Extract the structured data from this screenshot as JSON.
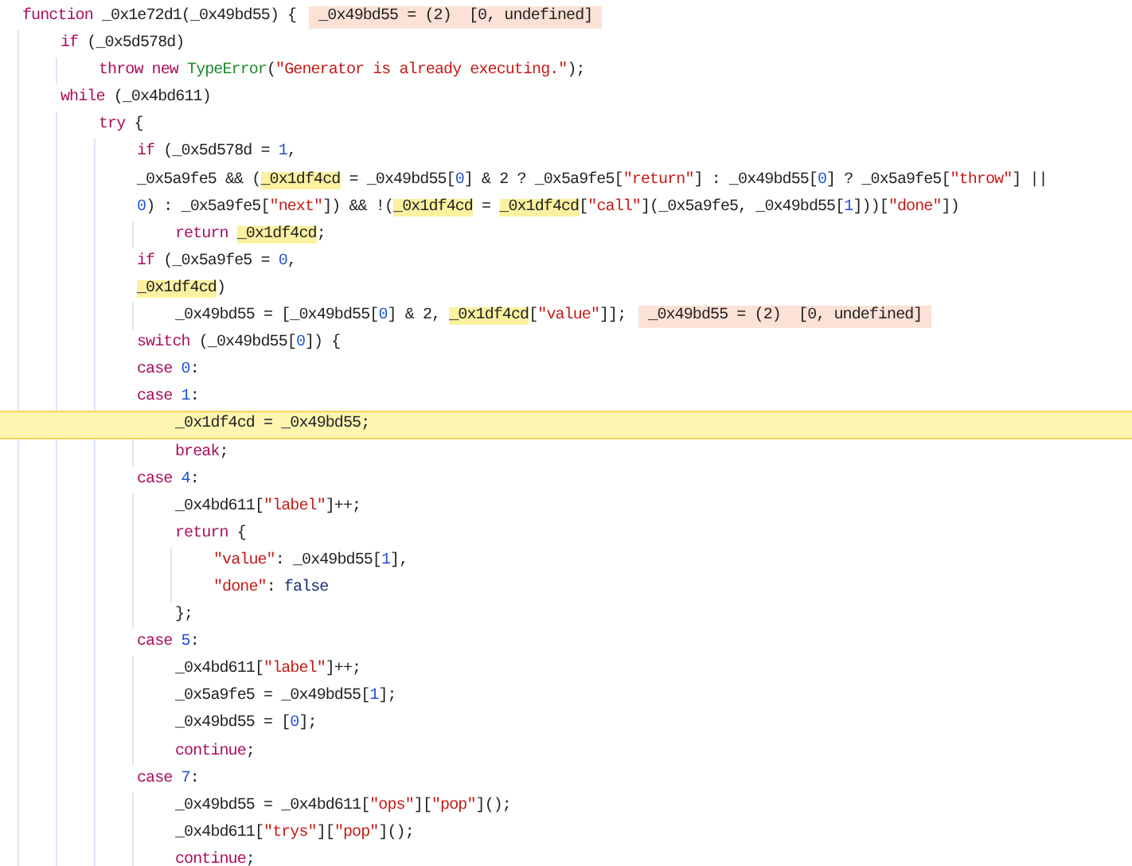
{
  "code": {
    "lines": [
      {
        "paused": false,
        "tokens": [
          {
            "kind": "kw",
            "text": "function"
          },
          {
            "kind": "p",
            "text": " _0x1e72d1(_0x49bd55) {"
          }
        ],
        "inline_value": "_0x49bd55 = (2)  [0, undefined]",
        "children": [
          {
            "paused": false,
            "tokens": [
              {
                "kind": "kw",
                "text": "if"
              },
              {
                "kind": "p",
                "text": " (_0x5d578d)"
              }
            ],
            "children": [
              {
                "paused": false,
                "tokens": [
                  {
                    "kind": "kw",
                    "text": "throw new "
                  },
                  {
                    "kind": "ty",
                    "text": "TypeError"
                  },
                  {
                    "kind": "p",
                    "text": "("
                  },
                  {
                    "kind": "s",
                    "text": "\"Generator is already executing.\""
                  },
                  {
                    "kind": "p",
                    "text": ");"
                  }
                ]
              }
            ]
          },
          {
            "paused": false,
            "tokens": [
              {
                "kind": "kw",
                "text": "while"
              },
              {
                "kind": "p",
                "text": " (_0x4bd611)"
              }
            ],
            "children": [
              {
                "paused": false,
                "tokens": [
                  {
                    "kind": "kw",
                    "text": "try"
                  },
                  {
                    "kind": "p",
                    "text": " {"
                  }
                ],
                "children": [
                  {
                    "paused": false,
                    "tokens": [
                      {
                        "kind": "kw",
                        "text": "if"
                      },
                      {
                        "kind": "p",
                        "text": " (_0x5d578d = "
                      },
                      {
                        "kind": "n",
                        "text": "1"
                      },
                      {
                        "kind": "p",
                        "text": ","
                      }
                    ]
                  },
                  {
                    "paused": false,
                    "tokens": [
                      {
                        "kind": "p",
                        "text": "_0x5a9fe5 && ("
                      },
                      {
                        "kind": "hl",
                        "text": "_0x1df4cd"
                      },
                      {
                        "kind": "p",
                        "text": " = _0x49bd55["
                      },
                      {
                        "kind": "n",
                        "text": "0"
                      },
                      {
                        "kind": "p",
                        "text": "] & 2 ? _0x5a9fe5["
                      },
                      {
                        "kind": "s",
                        "text": "\"return\""
                      },
                      {
                        "kind": "p",
                        "text": "] : _0x49bd55["
                      },
                      {
                        "kind": "n",
                        "text": "0"
                      },
                      {
                        "kind": "p",
                        "text": "] ? _0x5a9fe5["
                      },
                      {
                        "kind": "s",
                        "text": "\"throw\""
                      },
                      {
                        "kind": "p",
                        "text": "] ||"
                      }
                    ]
                  },
                  {
                    "paused": false,
                    "tokens": [
                      {
                        "kind": "n",
                        "text": "0"
                      },
                      {
                        "kind": "p",
                        "text": ") : _0x5a9fe5["
                      },
                      {
                        "kind": "s",
                        "text": "\"next\""
                      },
                      {
                        "kind": "p",
                        "text": "]) && !("
                      },
                      {
                        "kind": "hl",
                        "text": "_0x1df4cd"
                      },
                      {
                        "kind": "p",
                        "text": " = "
                      },
                      {
                        "kind": "hl",
                        "text": "_0x1df4cd"
                      },
                      {
                        "kind": "p",
                        "text": "["
                      },
                      {
                        "kind": "s",
                        "text": "\"call\""
                      },
                      {
                        "kind": "p",
                        "text": "](_0x5a9fe5, _0x49bd55["
                      },
                      {
                        "kind": "n",
                        "text": "1"
                      },
                      {
                        "kind": "p",
                        "text": "]))["
                      },
                      {
                        "kind": "s",
                        "text": "\"done\""
                      },
                      {
                        "kind": "p",
                        "text": "])"
                      }
                    ],
                    "children": [
                      {
                        "paused": false,
                        "tokens": [
                          {
                            "kind": "kw",
                            "text": "return "
                          },
                          {
                            "kind": "hl",
                            "text": "_0x1df4cd"
                          },
                          {
                            "kind": "p",
                            "text": ";"
                          }
                        ]
                      }
                    ]
                  },
                  {
                    "paused": false,
                    "tokens": [
                      {
                        "kind": "kw",
                        "text": "if"
                      },
                      {
                        "kind": "p",
                        "text": " (_0x5a9fe5 = "
                      },
                      {
                        "kind": "n",
                        "text": "0"
                      },
                      {
                        "kind": "p",
                        "text": ","
                      }
                    ]
                  },
                  {
                    "paused": false,
                    "tokens": [
                      {
                        "kind": "hl",
                        "text": "_0x1df4cd"
                      },
                      {
                        "kind": "p",
                        "text": ")"
                      }
                    ],
                    "children": [
                      {
                        "paused": false,
                        "tokens": [
                          {
                            "kind": "p",
                            "text": "_0x49bd55 = [_0x49bd55["
                          },
                          {
                            "kind": "n",
                            "text": "0"
                          },
                          {
                            "kind": "p",
                            "text": "] & 2, "
                          },
                          {
                            "kind": "hl",
                            "text": "_0x1df4cd"
                          },
                          {
                            "kind": "p",
                            "text": "["
                          },
                          {
                            "kind": "s",
                            "text": "\"value\""
                          },
                          {
                            "kind": "p",
                            "text": "]];"
                          }
                        ],
                        "inline_value": "_0x49bd55 = (2)  [0, undefined]"
                      }
                    ]
                  },
                  {
                    "paused": false,
                    "tokens": [
                      {
                        "kind": "kw",
                        "text": "switch"
                      },
                      {
                        "kind": "p",
                        "text": " (_0x49bd55["
                      },
                      {
                        "kind": "n",
                        "text": "0"
                      },
                      {
                        "kind": "p",
                        "text": "]) {"
                      }
                    ]
                  },
                  {
                    "paused": false,
                    "tokens": [
                      {
                        "kind": "kw",
                        "text": "case "
                      },
                      {
                        "kind": "n",
                        "text": "0"
                      },
                      {
                        "kind": "p",
                        "text": ":"
                      }
                    ]
                  },
                  {
                    "paused": false,
                    "tokens": [
                      {
                        "kind": "kw",
                        "text": "case "
                      },
                      {
                        "kind": "n",
                        "text": "1"
                      },
                      {
                        "kind": "p",
                        "text": ":"
                      }
                    ],
                    "children": [
                      {
                        "paused": true,
                        "tokens": [
                          {
                            "kind": "p",
                            "text": "_0x1df4cd = _0x49bd55;"
                          }
                        ]
                      },
                      {
                        "paused": false,
                        "tokens": [
                          {
                            "kind": "kw",
                            "text": "break"
                          },
                          {
                            "kind": "p",
                            "text": ";"
                          }
                        ]
                      }
                    ]
                  },
                  {
                    "paused": false,
                    "tokens": [
                      {
                        "kind": "kw",
                        "text": "case "
                      },
                      {
                        "kind": "n",
                        "text": "4"
                      },
                      {
                        "kind": "p",
                        "text": ":"
                      }
                    ],
                    "children": [
                      {
                        "paused": false,
                        "tokens": [
                          {
                            "kind": "p",
                            "text": "_0x4bd611["
                          },
                          {
                            "kind": "s",
                            "text": "\"label\""
                          },
                          {
                            "kind": "p",
                            "text": "]++;"
                          }
                        ]
                      },
                      {
                        "paused": false,
                        "tokens": [
                          {
                            "kind": "kw",
                            "text": "return"
                          },
                          {
                            "kind": "p",
                            "text": " {"
                          }
                        ],
                        "children": [
                          {
                            "paused": false,
                            "tokens": [
                              {
                                "kind": "s",
                                "text": "\"value\""
                              },
                              {
                                "kind": "p",
                                "text": ": _0x49bd55["
                              },
                              {
                                "kind": "n",
                                "text": "1"
                              },
                              {
                                "kind": "p",
                                "text": "],"
                              }
                            ]
                          },
                          {
                            "paused": false,
                            "tokens": [
                              {
                                "kind": "s",
                                "text": "\"done\""
                              },
                              {
                                "kind": "p",
                                "text": ": "
                              },
                              {
                                "kind": "lit",
                                "text": "false"
                              }
                            ]
                          }
                        ]
                      },
                      {
                        "paused": false,
                        "tokens": [
                          {
                            "kind": "p",
                            "text": "};"
                          }
                        ]
                      }
                    ]
                  },
                  {
                    "paused": false,
                    "tokens": [
                      {
                        "kind": "kw",
                        "text": "case "
                      },
                      {
                        "kind": "n",
                        "text": "5"
                      },
                      {
                        "kind": "p",
                        "text": ":"
                      }
                    ],
                    "children": [
                      {
                        "paused": false,
                        "tokens": [
                          {
                            "kind": "p",
                            "text": "_0x4bd611["
                          },
                          {
                            "kind": "s",
                            "text": "\"label\""
                          },
                          {
                            "kind": "p",
                            "text": "]++;"
                          }
                        ]
                      },
                      {
                        "paused": false,
                        "tokens": [
                          {
                            "kind": "p",
                            "text": "_0x5a9fe5 = _0x49bd55["
                          },
                          {
                            "kind": "n",
                            "text": "1"
                          },
                          {
                            "kind": "p",
                            "text": "];"
                          }
                        ]
                      },
                      {
                        "paused": false,
                        "tokens": [
                          {
                            "kind": "p",
                            "text": "_0x49bd55 = ["
                          },
                          {
                            "kind": "n",
                            "text": "0"
                          },
                          {
                            "kind": "p",
                            "text": "];"
                          }
                        ]
                      },
                      {
                        "paused": false,
                        "tokens": [
                          {
                            "kind": "kw",
                            "text": "continue"
                          },
                          {
                            "kind": "p",
                            "text": ";"
                          }
                        ]
                      }
                    ]
                  },
                  {
                    "paused": false,
                    "tokens": [
                      {
                        "kind": "kw",
                        "text": "case "
                      },
                      {
                        "kind": "n",
                        "text": "7"
                      },
                      {
                        "kind": "p",
                        "text": ":"
                      }
                    ],
                    "children": [
                      {
                        "paused": false,
                        "tokens": [
                          {
                            "kind": "p",
                            "text": "_0x49bd55 = _0x4bd611["
                          },
                          {
                            "kind": "s",
                            "text": "\"ops\""
                          },
                          {
                            "kind": "p",
                            "text": "]["
                          },
                          {
                            "kind": "s",
                            "text": "\"pop\""
                          },
                          {
                            "kind": "p",
                            "text": "]();"
                          }
                        ]
                      },
                      {
                        "paused": false,
                        "tokens": [
                          {
                            "kind": "p",
                            "text": "_0x4bd611["
                          },
                          {
                            "kind": "s",
                            "text": "\"trys\""
                          },
                          {
                            "kind": "p",
                            "text": "]["
                          },
                          {
                            "kind": "s",
                            "text": "\"pop\""
                          },
                          {
                            "kind": "p",
                            "text": "]();"
                          }
                        ]
                      },
                      {
                        "paused": false,
                        "tokens": [
                          {
                            "kind": "kw",
                            "text": "continue"
                          },
                          {
                            "kind": "p",
                            "text": ";"
                          }
                        ]
                      }
                    ]
                  }
                ]
              }
            ]
          }
        ]
      }
    ]
  }
}
